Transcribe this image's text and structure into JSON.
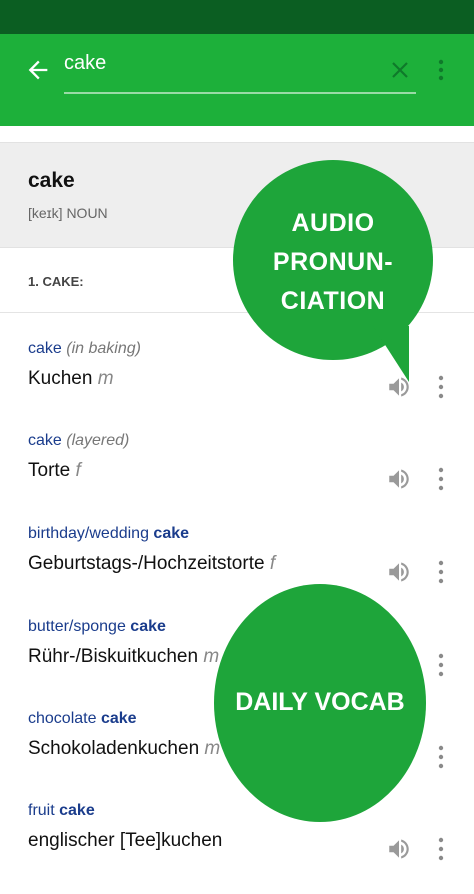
{
  "search": {
    "query": "cake"
  },
  "entry": {
    "headword": "cake",
    "phonetic": "[keɪk] NOUN"
  },
  "sense": {
    "label": "1. CAKE:"
  },
  "translations": [
    {
      "src_pre": "",
      "src_bold": "",
      "src_plain": "cake",
      "note": "(in baking)",
      "target": "Kuchen",
      "gender": "m"
    },
    {
      "src_pre": "",
      "src_bold": "",
      "src_plain": "cake",
      "note": "(layered)",
      "target": "Torte",
      "gender": "f"
    },
    {
      "src_pre": "birthday/wedding ",
      "src_bold": "cake",
      "src_plain": "",
      "note": "",
      "target": "Geburtstags-/Hochzeitstorte",
      "gender": "f"
    },
    {
      "src_pre": "butter/sponge ",
      "src_bold": "cake",
      "src_plain": "",
      "note": "",
      "target": "Rühr-/Biskuitkuchen",
      "gender": "m"
    },
    {
      "src_pre": "chocolate ",
      "src_bold": "cake",
      "src_plain": "",
      "note": "",
      "target": "Schokoladenkuchen",
      "gender": "m"
    },
    {
      "src_pre": "fruit ",
      "src_bold": "cake",
      "src_plain": "",
      "note": "",
      "target": "englischer [Tee]kuchen",
      "gender": ""
    }
  ],
  "promo": {
    "bubble1": "AUDIO PRONUN- CIATION",
    "bubble2": "DAILY VOCAB"
  },
  "colors": {
    "status_bar": "#0b5e22",
    "app_bar": "#1db03a",
    "bubble": "#1ea53a",
    "link": "#1a3c8c"
  }
}
